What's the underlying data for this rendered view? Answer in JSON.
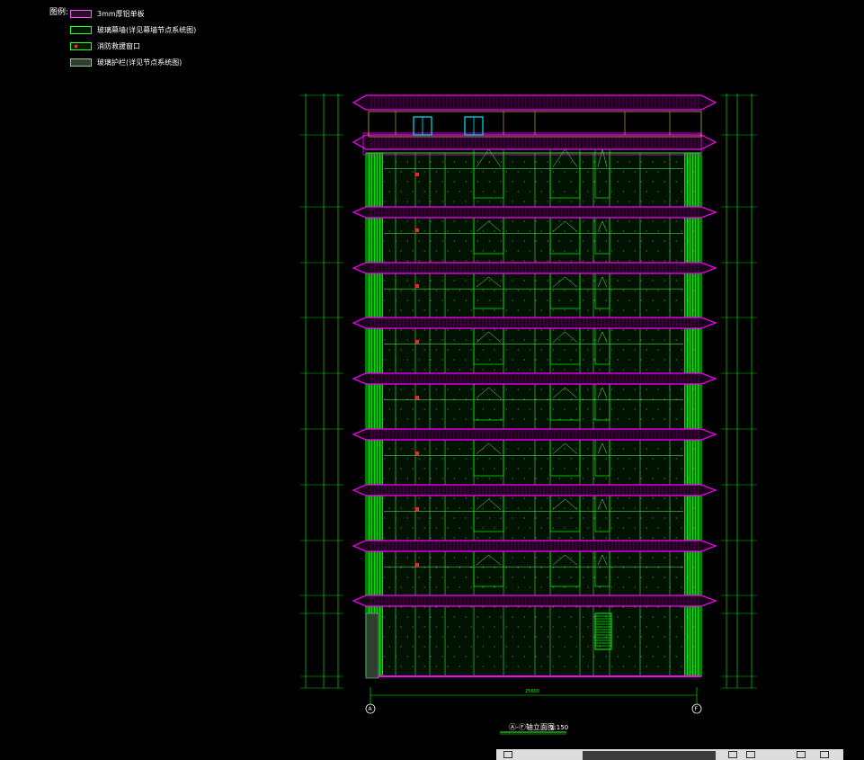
{
  "legend": {
    "title": "图例:",
    "items": [
      {
        "label": "3mm厚铝单板",
        "swatch_fill": "#2a0d2a",
        "swatch_stroke": "#ff55ff"
      },
      {
        "label": "玻璃幕墙(详见幕墙节点系统图)",
        "swatch_fill": "#001a00",
        "swatch_stroke": "#33ff33"
      },
      {
        "label": "消防救援窗口",
        "swatch_fill": "#001a00",
        "swatch_stroke": "#33ff33"
      },
      {
        "label": "玻璃护栏(详见节点系统图)",
        "swatch_fill": "#2f3f2f",
        "swatch_stroke": "#9fbf9f"
      }
    ]
  },
  "drawing": {
    "title": "Ⓐ-Ⓕ轴立面图",
    "scale": "1:150",
    "axis_left": "A",
    "axis_right": "F",
    "overall_dim": "25600",
    "colors": {
      "curtain_wall": "#00ff00",
      "aluminum_panel": "#ff00ff",
      "dimension": "#00ff00",
      "mullion": "#66ff66",
      "rescue_window": "#ff2222",
      "roof_door": "#00e5ff",
      "parapet": "#ffe066"
    }
  }
}
